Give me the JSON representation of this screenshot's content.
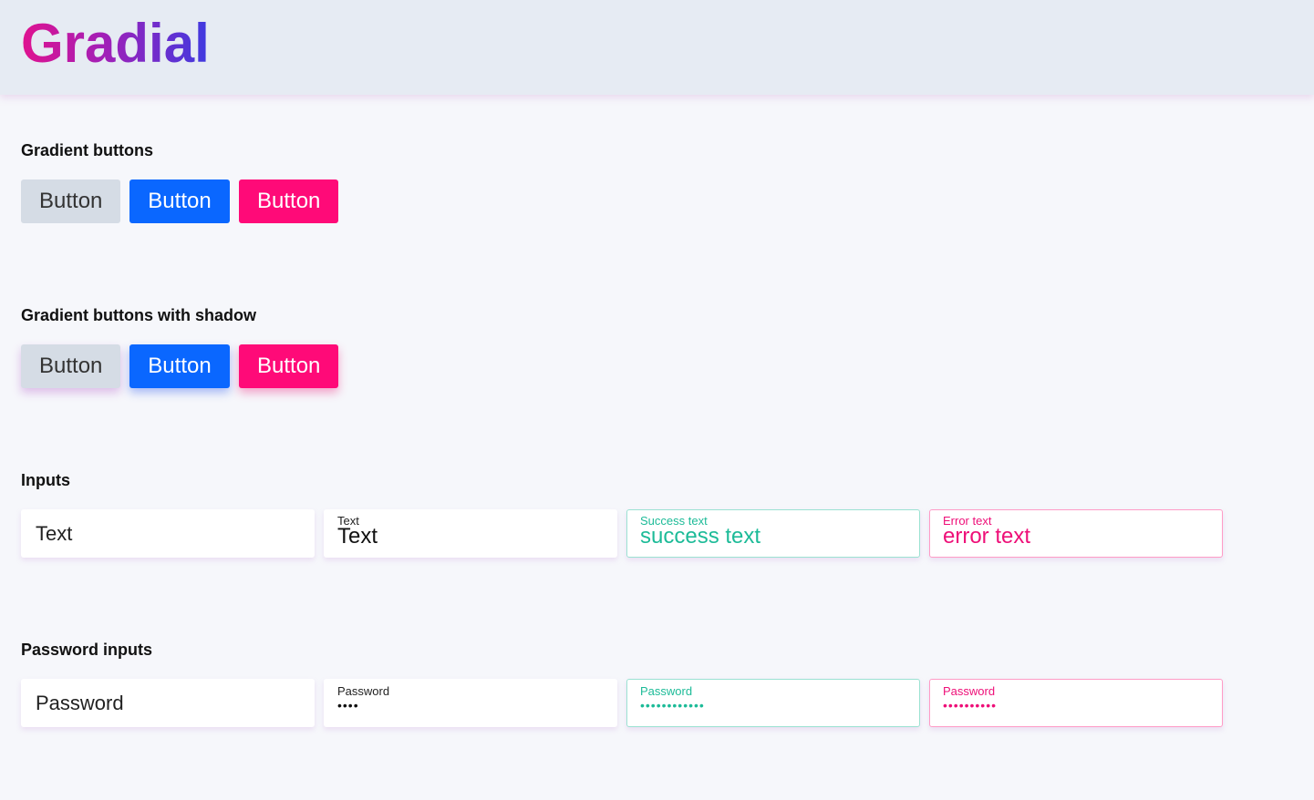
{
  "header": {
    "logo": "Gradial"
  },
  "sections": {
    "gradient_buttons": {
      "title": "Gradient buttons",
      "buttons": [
        "Button",
        "Button",
        "Button"
      ]
    },
    "gradient_buttons_shadow": {
      "title": "Gradient buttons with shadow",
      "buttons": [
        "Button",
        "Button",
        "Button"
      ]
    },
    "inputs": {
      "title": "Inputs",
      "fields": [
        {
          "placeholder": "Text"
        },
        {
          "label": "Text",
          "value": "Text"
        },
        {
          "label": "Success text",
          "value": "success text"
        },
        {
          "label": "Error text",
          "value": "error text"
        }
      ]
    },
    "password_inputs": {
      "title": "Password inputs",
      "fields": [
        {
          "placeholder": "Password"
        },
        {
          "label": "Password",
          "value": "••••"
        },
        {
          "label": "Password",
          "value": "••••••••••••"
        },
        {
          "label": "Password",
          "value": "••••••••••"
        }
      ]
    }
  },
  "colors": {
    "gray": "#d5dce5",
    "blue": "#0a67ff",
    "pink": "#ff0a78",
    "success": "#1dbb98",
    "error": "#ee0f78",
    "header_bg": "#e6ebf3",
    "page_bg": "#f6f7fb"
  }
}
